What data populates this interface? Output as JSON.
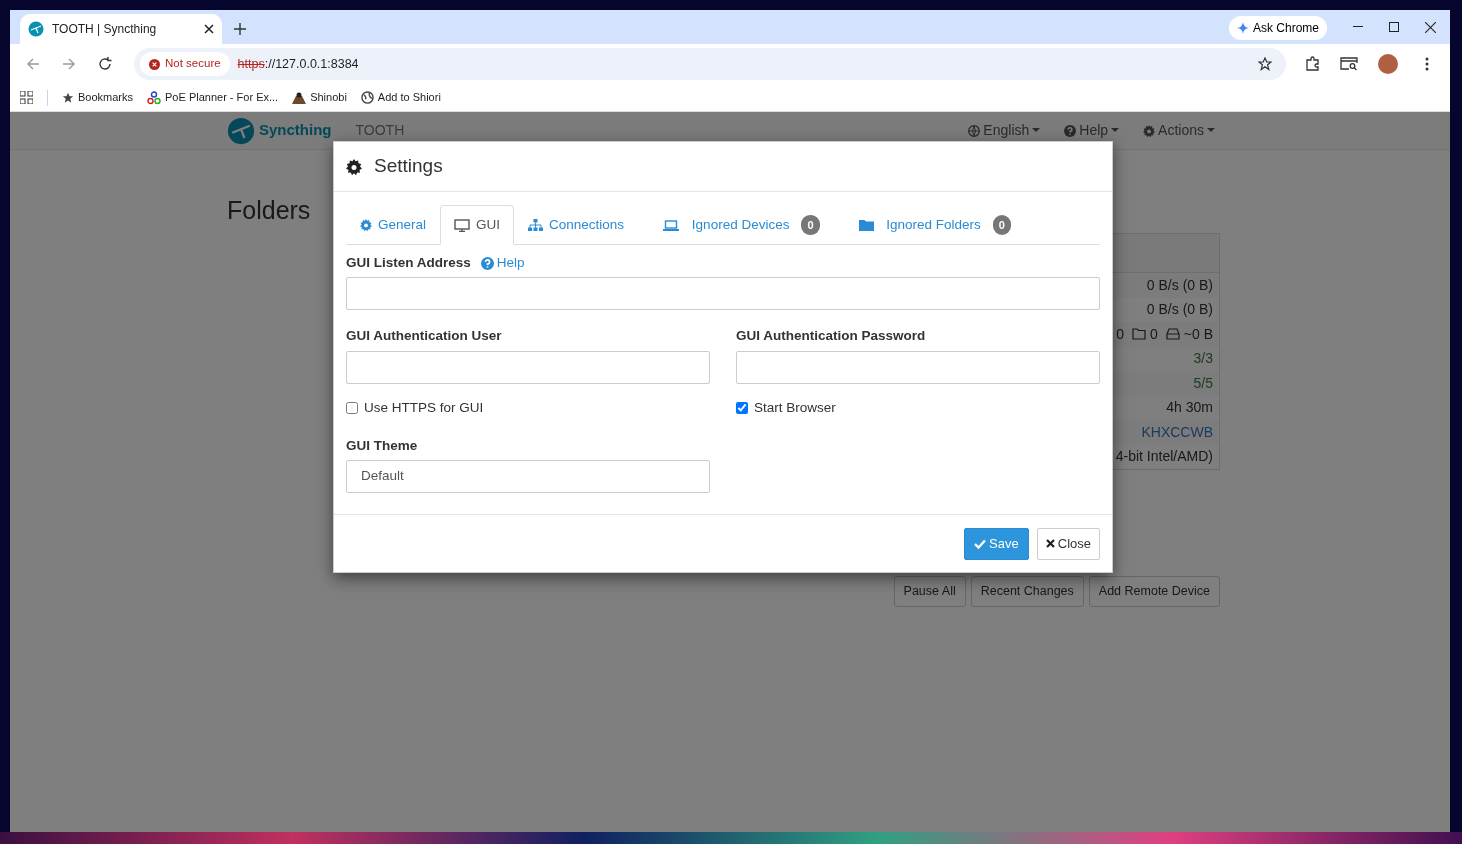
{
  "browser": {
    "tab_title": "TOOTH | Syncthing",
    "ask_chrome": "Ask Chrome",
    "security": "Not secure",
    "scheme": "https",
    "address_rest": "://127.0.0.1:8384",
    "bookmarks": [
      "Bookmarks",
      "PoE Planner - For Ex...",
      "Shinobi",
      "Add to Shiori"
    ]
  },
  "app": {
    "brand": "Syncthing",
    "device_name": "TOOTH",
    "menus": [
      "English",
      "Help",
      "Actions"
    ],
    "heading": "Folders",
    "device_rows": [
      {
        "kind": "plain",
        "text": "0 B/s (0 B)"
      },
      {
        "kind": "plain",
        "text": "0 B/s (0 B)"
      },
      {
        "kind": "stats",
        "parts": [
          "0",
          "0",
          "~0 B"
        ]
      },
      {
        "kind": "ok",
        "text": "3/3"
      },
      {
        "kind": "ok",
        "text": "5/5"
      },
      {
        "kind": "plain",
        "text": "4h 30m"
      },
      {
        "kind": "link",
        "text": "KHXCCWB"
      },
      {
        "kind": "plain",
        "text": "4-bit Intel/AMD)"
      }
    ],
    "device_buttons": [
      "Pause All",
      "Recent Changes",
      "Add Remote Device"
    ]
  },
  "modal": {
    "title": "Settings",
    "tabs": [
      {
        "label": "General",
        "selected": false
      },
      {
        "label": "GUI",
        "selected": true
      },
      {
        "label": "Connections",
        "selected": false
      },
      {
        "label": "Ignored Devices",
        "selected": false,
        "badge": "0"
      },
      {
        "label": "Ignored Folders",
        "selected": false,
        "badge": "0"
      }
    ],
    "listen_address": {
      "label": "GUI Listen Address",
      "help": "Help"
    },
    "auth_user": {
      "label": "GUI Authentication User"
    },
    "auth_password": {
      "label": "GUI Authentication Password"
    },
    "use_https": {
      "label": "Use HTTPS for GUI",
      "checked": false
    },
    "start_browser": {
      "label": "Start Browser",
      "checked": true
    },
    "theme": {
      "label": "GUI Theme",
      "value": "Default"
    },
    "save": "Save",
    "close": "Close"
  }
}
